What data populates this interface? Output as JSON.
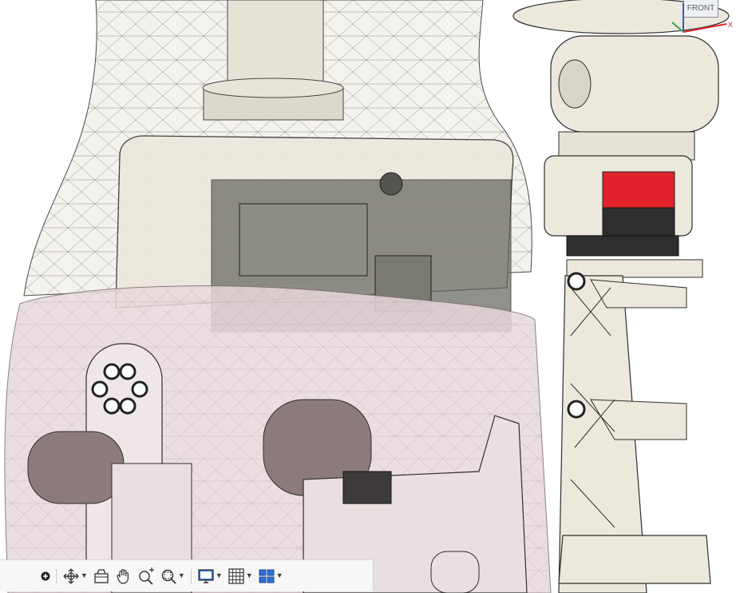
{
  "viewcube": {
    "face_label": "FRONT"
  },
  "navbar": {
    "tools": [
      {
        "name": "orbit",
        "icon": "orbit-icon",
        "has_menu": true
      },
      {
        "name": "look-at",
        "icon": "look-at-icon",
        "has_menu": false
      },
      {
        "name": "pan",
        "icon": "pan-hand-icon",
        "has_menu": false
      },
      {
        "name": "zoom",
        "icon": "zoom-icon",
        "has_menu": false
      },
      {
        "name": "fit",
        "icon": "zoom-window-icon",
        "has_menu": true
      },
      {
        "name": "display-settings",
        "icon": "display-monitor-icon",
        "has_menu": true
      },
      {
        "name": "grid-and-snaps",
        "icon": "grid-icon",
        "has_menu": true
      },
      {
        "name": "viewports",
        "icon": "viewports-icon",
        "has_menu": true
      }
    ]
  },
  "colors": {
    "body_cream": "#ece8dc",
    "body_dark": "#5a5a55",
    "skin_pink": "#dcc8cc",
    "accent_red": "#e0232b",
    "servo_dark": "#2f2f2f",
    "wire": "#3a3a3a"
  }
}
